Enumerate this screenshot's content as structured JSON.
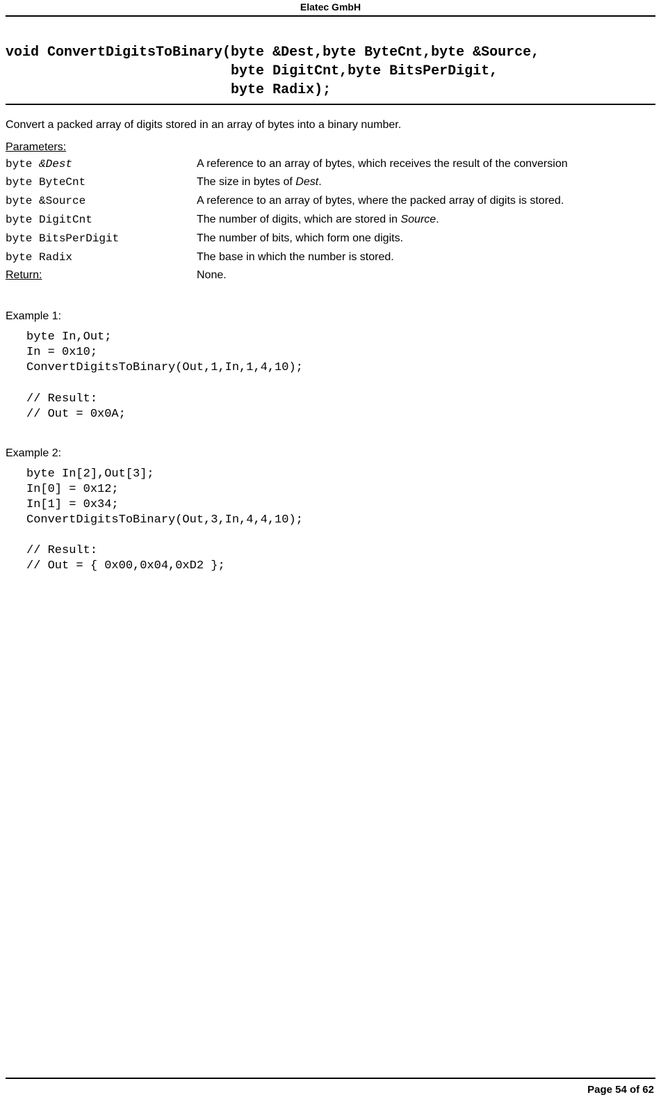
{
  "header": {
    "company": "Elatec GmbH"
  },
  "signature": "void ConvertDigitsToBinary(byte &Dest,byte ByteCnt,byte &Source,\n                           byte DigitCnt,byte BitsPerDigit,\n                           byte Radix);",
  "description": "Convert a packed array of digits stored in an array of bytes into a binary number.",
  "parameters_heading": "Parameters:",
  "parameters": [
    {
      "type": "byte ",
      "name": "&Dest",
      "name_italic": true,
      "desc_pre": "A reference to an array of bytes, which receives the result of the conversion",
      "desc_ital": "",
      "desc_post": ""
    },
    {
      "type": "byte ",
      "name": "ByteCnt",
      "name_italic": false,
      "desc_pre": "The size in bytes of ",
      "desc_ital": "Dest",
      "desc_post": "."
    },
    {
      "type": "byte ",
      "name": "&Source",
      "name_italic": false,
      "desc_pre": "A reference to an array of bytes, where the packed array of digits is stored.",
      "desc_ital": "",
      "desc_post": ""
    },
    {
      "type": "byte ",
      "name": "DigitCnt",
      "name_italic": false,
      "desc_pre": "The number of digits, which are stored in ",
      "desc_ital": "Source",
      "desc_post": "."
    },
    {
      "type": "byte ",
      "name": "BitsPerDigit",
      "name_italic": false,
      "desc_pre": "The number of bits, which form one digits.",
      "desc_ital": "",
      "desc_post": ""
    },
    {
      "type": "byte ",
      "name": "Radix",
      "name_italic": false,
      "desc_pre": "The base in which the number is stored.",
      "desc_ital": "",
      "desc_post": ""
    }
  ],
  "return": {
    "label": "Return:",
    "value": "None."
  },
  "examples": [
    {
      "label": "Example 1:",
      "code": "byte In,Out;\nIn = 0x10;\nConvertDigitsToBinary(Out,1,In,1,4,10);\n\n// Result:\n// Out = 0x0A;"
    },
    {
      "label": "Example 2:",
      "code": "byte In[2],Out[3];\nIn[0] = 0x12;\nIn[1] = 0x34;\nConvertDigitsToBinary(Out,3,In,4,4,10);\n\n// Result:\n// Out = { 0x00,0x04,0xD2 };"
    }
  ],
  "footer": {
    "page_label": "Page 54 of 62"
  }
}
